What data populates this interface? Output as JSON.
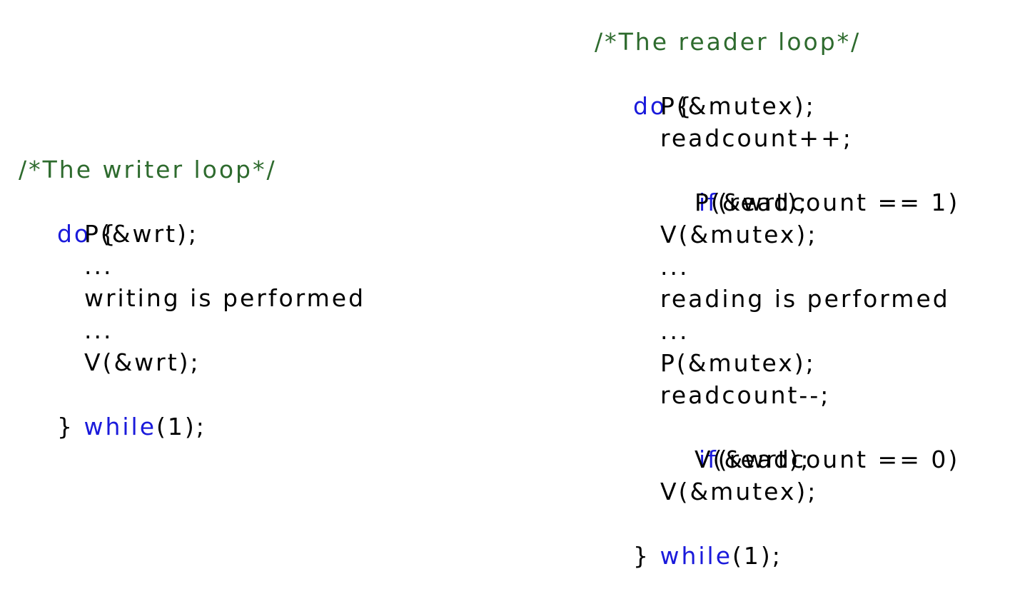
{
  "writer": {
    "comment": "/*The writer loop*/",
    "do_kw": "do",
    "open_brace": " {",
    "lines": [
      "P(&wrt);",
      "...",
      "writing is performed",
      "...",
      "V(&wrt);"
    ],
    "close_brace": "} ",
    "while_kw": "while",
    "while_tail": "(1);"
  },
  "reader": {
    "comment": "/*The reader loop*/",
    "do_kw": "do",
    "open_brace": " {",
    "line_p_mutex_1": "P(&mutex);",
    "line_inc": "readcount++;",
    "if_kw_1": "if",
    "if_cond_1": "(readcount == 1)",
    "line_p_wrt": "P(&wrt);",
    "line_v_mutex_1": "V(&mutex);",
    "ellipsis_1": "...",
    "line_reading": "reading is performed",
    "ellipsis_2": "...",
    "line_p_mutex_2": "P(&mutex);",
    "line_dec": "readcount--;",
    "if_kw_2": "if",
    "if_cond_2": "(readcount == 0)",
    "line_v_wrt": "V(&wrt);",
    "line_v_mutex_2": "V(&mutex);",
    "close_brace": "} ",
    "while_kw": "while",
    "while_tail": "(1);"
  },
  "colors": {
    "comment": "#2e6b2e",
    "keyword": "#1a1adb",
    "text": "#000000"
  }
}
